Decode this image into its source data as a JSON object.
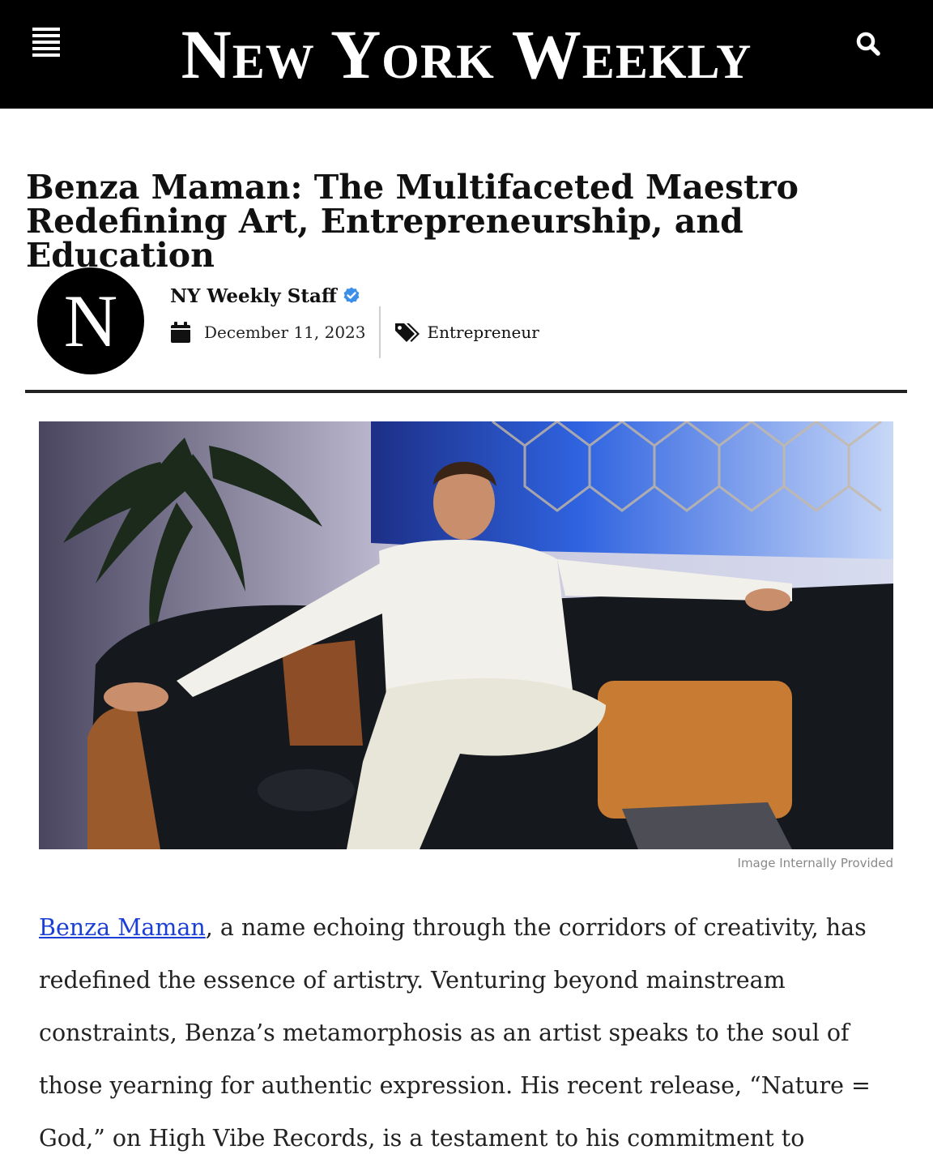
{
  "header": {
    "site_name": "New York Weekly",
    "menu_icon": "hamburger-menu-icon",
    "search_icon": "search-icon"
  },
  "article": {
    "title": "Benza Maman: The Multifaceted Maestro Redefining Art, Entrepreneurship, and Education",
    "author": {
      "avatar_letter": "N",
      "name": "NY Weekly Staff",
      "verified_icon": "verified-badge-icon"
    },
    "date": "December 11, 2023",
    "date_icon": "calendar-icon",
    "category": "Entrepreneur",
    "category_icon": "tags-icon",
    "image": {
      "description_icon": "photo",
      "caption": "Image Internally Provided"
    },
    "body": {
      "link_text": "Benza Maman",
      "paragraph_rest": ", a name echoing through the corridors of creativity, has redefined the essence of artistry. Venturing beyond mainstream constraints, Benza’s metamorphosis as an artist speaks to the soul of those yearning for authentic expression. His recent release, “Nature = God,” on High Vibe Records, is a testament to his commitment to spiritual"
    }
  },
  "colors": {
    "header_bg": "#000000",
    "link": "#1a3fd6",
    "verified": "#3b8fe8"
  }
}
